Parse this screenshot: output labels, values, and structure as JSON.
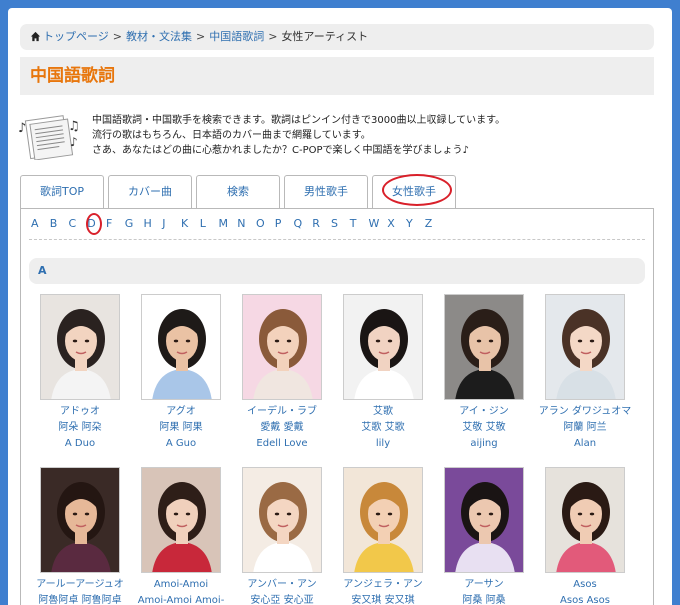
{
  "breadcrumb": {
    "home": "トップページ",
    "items": [
      "教材・文法集",
      "中国語歌詞"
    ],
    "separator": ">",
    "current": "女性アーティスト"
  },
  "page_title": "中国語歌詞",
  "intro": {
    "lines": [
      "中国語歌詞・中国歌手を検索できます。歌詞はピンイン付きで3000曲以上収録しています。",
      "流行の歌はもちろん、日本語のカバー曲まで網羅しています。",
      "さあ、あなたはどの曲に心惹かれましたか？C-POPで楽しく中国語を学びましょう♪"
    ]
  },
  "tabs": [
    {
      "label": "歌詞TOP"
    },
    {
      "label": "カバー曲"
    },
    {
      "label": "検索"
    },
    {
      "label": "男性歌手"
    },
    {
      "label": "女性歌手",
      "active": true
    }
  ],
  "alphabet": [
    "A",
    "B",
    "C",
    "D",
    "F",
    "G",
    "H",
    "J",
    "K",
    "L",
    "M",
    "N",
    "O",
    "P",
    "Q",
    "R",
    "S",
    "T",
    "W",
    "X",
    "Y",
    "Z"
  ],
  "section": {
    "letter": "A"
  },
  "artists": [
    {
      "kana": "アドゥオ",
      "chinese": "阿朵 阿朶",
      "romaji": "A Duo",
      "photo": "portrait-a-duo"
    },
    {
      "kana": "アグオ",
      "chinese": "阿果 阿果",
      "romaji": "A Guo",
      "photo": "portrait-a-guo"
    },
    {
      "kana": "イーデル・ラブ",
      "chinese": "愛戴 愛戴",
      "romaji": "Edell Love",
      "photo": "portrait-edell-love"
    },
    {
      "kana": "艾歌",
      "chinese": "艾歌 艾歌",
      "romaji": "lily",
      "photo": "portrait-lily"
    },
    {
      "kana": "アイ・ジン",
      "chinese": "艾敬 艾敬",
      "romaji": "aijing",
      "photo": "portrait-aijing"
    },
    {
      "kana": "アラン ダワジュオマ",
      "chinese": "阿蘭 阿兰",
      "romaji": "Alan",
      "photo": "portrait-alan"
    },
    {
      "kana": "アールーアージュオ",
      "chinese": "阿魯阿卓 阿鲁阿卓",
      "romaji": "",
      "photo": "portrait-aluazhuo"
    },
    {
      "kana": "Amoi-Amoi",
      "chinese": "Amoi-Amoi Amoi-",
      "romaji": "",
      "photo": "portrait-amoi"
    },
    {
      "kana": "アンバー・アン",
      "chinese": "安心亞 安心亚",
      "romaji": "",
      "photo": "portrait-amber-an"
    },
    {
      "kana": "アンジェラ・アン",
      "chinese": "安又琪 安又琪",
      "romaji": "",
      "photo": "portrait-angela-an"
    },
    {
      "kana": "アーサン",
      "chinese": "阿桑 阿桑",
      "romaji": "",
      "photo": "portrait-asan"
    },
    {
      "kana": "Asos",
      "chinese": "Asos Asos",
      "romaji": "",
      "photo": "portrait-asos"
    }
  ],
  "colors": {
    "frame": "#3f7fcf",
    "link": "#2f6fb0",
    "title": "#e8760c",
    "highlight": "#d9202a",
    "panel_bg": "#eeeeee"
  }
}
